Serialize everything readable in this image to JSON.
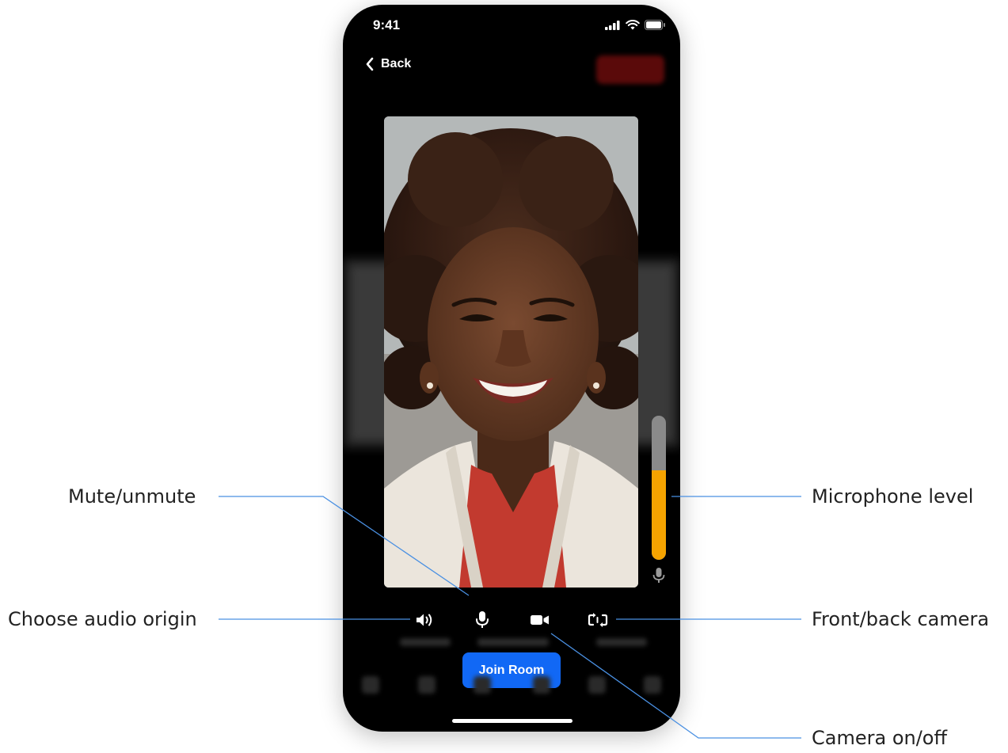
{
  "status_bar": {
    "time": "9:41"
  },
  "nav": {
    "back_label": "Back"
  },
  "preview": {
    "microphone_level": 0.62,
    "colors": {
      "meter_fill": "#f5a300",
      "meter_track": "#8a8a8a",
      "join_button": "#1168f5",
      "callout_line": "#4a90e2"
    }
  },
  "controls": {
    "audio_output_icon": "speaker-icon",
    "mute_icon": "microphone-icon",
    "camera_icon": "video-camera-icon",
    "switch_camera_icon": "camera-switch-icon"
  },
  "join_button_label": "Join Room",
  "callouts": {
    "mute": "Mute/unmute",
    "audio_origin": "Choose audio origin",
    "mic_level": "Microphone level",
    "front_back": "Front/back camera",
    "camera_toggle": "Camera on/off"
  }
}
